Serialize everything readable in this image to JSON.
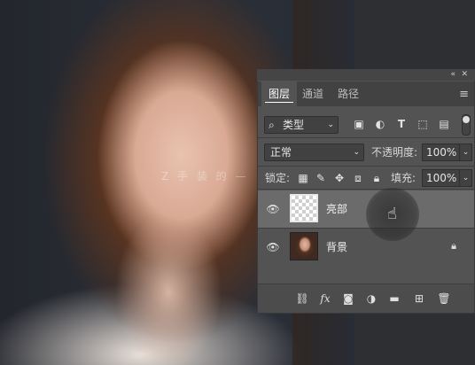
{
  "watermark": "Z 手 装 的 —",
  "panel": {
    "tabs": [
      {
        "label": "图层",
        "active": true
      },
      {
        "label": "通道",
        "active": false
      },
      {
        "label": "路径",
        "active": false
      }
    ],
    "filter": {
      "label": "类型"
    },
    "filter_icons": [
      "image-filter-icon",
      "adjustment-filter-icon",
      "type-filter-icon",
      "shape-filter-icon",
      "smart-object-filter-icon"
    ],
    "blend_mode": "正常",
    "opacity_label": "不透明度:",
    "opacity_value": "100%",
    "lock_label": "锁定:",
    "fill_label": "填充:",
    "fill_value": "100%",
    "layers": [
      {
        "name": "亮部",
        "visible": true,
        "selected": true,
        "thumbnail": "transparent"
      },
      {
        "name": "背景",
        "visible": true,
        "selected": false,
        "thumbnail": "portrait",
        "locked": true
      }
    ],
    "bottom_icons": [
      "link-icon",
      "fx-icon",
      "mask-icon",
      "adjustment-icon",
      "group-folder-icon",
      "new-layer-icon",
      "delete-icon"
    ]
  }
}
